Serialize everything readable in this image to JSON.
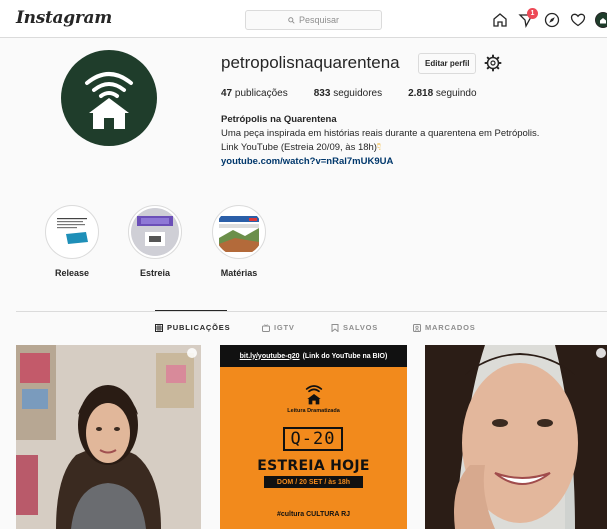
{
  "nav": {
    "logo": "Instagram",
    "search_placeholder": "Pesquisar",
    "notification_count": "1",
    "icons": [
      "home-icon",
      "direct-icon",
      "explore-icon",
      "heart-icon",
      "profile-avatar"
    ]
  },
  "profile": {
    "username": "petropolisnaquarentena",
    "edit_label": "Editar perfil",
    "stats": {
      "posts_count": "47",
      "posts_label": "publicações",
      "followers_count": "833",
      "followers_label": "seguidores",
      "following_count": "2.818",
      "following_label": "seguindo"
    },
    "bio": {
      "full_name": "Petrópolis na Quarentena",
      "line1": "Uma peça inspirada em histórias reais durante a quarentena em Petrópolis.",
      "line2": "Link YouTube (Estreia 20/09, às 18h)",
      "link": "youtube.com/watch?v=nRal7mUK9UA"
    }
  },
  "highlights": [
    {
      "label": "Release"
    },
    {
      "label": "Estreia"
    },
    {
      "label": "Matérias"
    }
  ],
  "tabs": [
    {
      "label": "PUBLICAÇÕES",
      "active": true
    },
    {
      "label": "IGTV",
      "active": false
    },
    {
      "label": "SALVOS",
      "active": false
    },
    {
      "label": "MARCADOS",
      "active": false
    }
  ],
  "posts": {
    "p2": {
      "top_link": "bit.ly/youtube-q20",
      "top_note": "(Link do YouTube na BIO)",
      "leitura": "Leitura Dramatizada",
      "title": "Q-20",
      "estreia": "ESTREIA HOJE",
      "date": "DOM / 20 SET / às 18h",
      "footer": "#cultura   CULTURA   RJ"
    }
  },
  "colors": {
    "accent_green": "#1f3d2b",
    "badge_red": "#ed4956",
    "link_blue": "#00376b",
    "poster_orange": "#f28a1c"
  }
}
